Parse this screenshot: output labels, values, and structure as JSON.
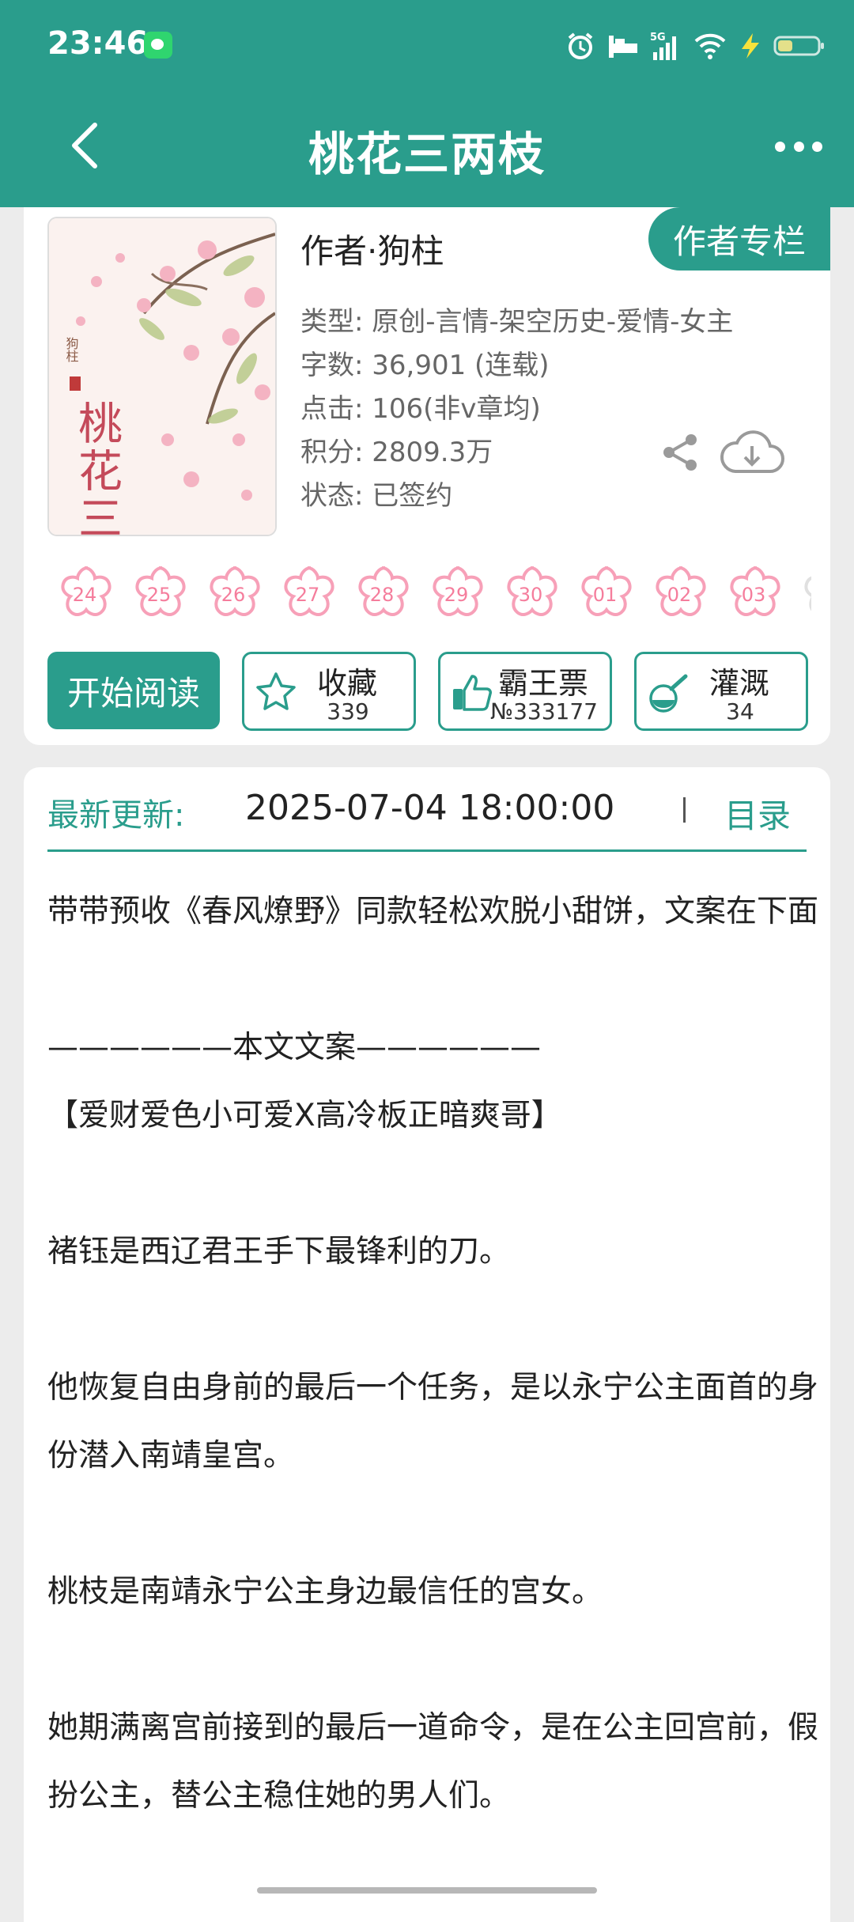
{
  "status_bar": {
    "time": "23:46",
    "network": "5G"
  },
  "header": {
    "title": "桃花三两枝"
  },
  "book": {
    "cover_author": "狗柱",
    "cover_title": "桃花三两枝",
    "author_line": "作者·狗柱",
    "author_column_label": "作者专栏",
    "meta": [
      "类型: 原创-言情-架空历史-爱情-女主",
      "字数: 36,901 (连载)",
      "点击: 106(非v章均)",
      "积分: 2809.3万",
      "状态: 已签约"
    ]
  },
  "calendar_days": [
    "24",
    "25",
    "26",
    "27",
    "28",
    "29",
    "30",
    "01",
    "02",
    "03"
  ],
  "actions": {
    "read_label": "开始阅读",
    "favorite": {
      "label": "收藏",
      "count": "339"
    },
    "bawang": {
      "label": "霸王票",
      "count": "№333177"
    },
    "irrigate": {
      "label": "灌溉",
      "count": "34"
    }
  },
  "update": {
    "label": "最新更新:",
    "date": "2025-07-04 18:00:00",
    "toc_label": "目录"
  },
  "description": [
    "带带预收《春风燎野》同款轻松欢脱小甜饼，文案在下面",
    "",
    "——————本文文案——————",
    "【爱财爱色小可爱X高冷板正暗爽哥】",
    "",
    "褚钰是西辽君王手下最锋利的刀。",
    "",
    "他恢复自由身前的最后一个任务，是以永宁公主面首的身份潜入南靖皇宫。",
    "",
    "桃枝是南靖永宁公主身边最信任的宫女。",
    "",
    "她期满离宫前接到的最后一道命令，是在公主回宫前，假扮公主，替公主稳住她的男人们。"
  ],
  "colors": {
    "primary": "#2a9d8c",
    "flower": "#f57d9c"
  }
}
